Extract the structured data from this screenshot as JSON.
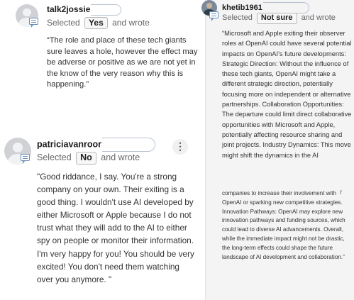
{
  "comments": [
    {
      "username": "talk2jossie",
      "selected_prefix": "Selected",
      "choice": "Yes",
      "selected_suffix": "and wrote",
      "text": "“The role and place of these tech giants sure leaves a hole, however the effect may be adverse or positive as we are not yet in the know of the very reason why this is happening.”"
    },
    {
      "username": "khetib1961",
      "selected_prefix": "Selected",
      "choice": "Not sure",
      "selected_suffix": "and wrote",
      "text_large": "“Microsoft and Apple exiting their observer roles at OpenAI could have several potential impacts on OpenAI's future developments: Strategic Direction: Without the influence of these tech giants, OpenAI might take a different strategic direction, potentially focusing more on independent or alternative partnerships. Collaboration Opportunities: The departure could limit direct collaborative opportunities with Microsoft and Apple, potentially affecting resource sharing and joint projects. Industry Dynamics: This move might shift the dynamics in the AI",
      "text_small": "companies to increase their involvement with OpenAI or sparking new competitive strategies. Innovation Pathways: OpenAI may explore new innovation pathways and funding sources, which could lead to diverse AI advancements. Overall, while the immediate impact might not be drastic, the long-term effects could shape the future landscape of AI development and collaboration.”",
      "stray_mark": "r"
    },
    {
      "username": "patriciavanroor",
      "selected_prefix": "Selected",
      "choice": "No",
      "selected_suffix": "and wrote",
      "text": "\"Good riddance, I say. You're a strong company on your own. Their exiting is a good thing. I wouldn't use AI developed by either Microsoft or Apple because I do not trust what they will add to the AI to either spy on people or monitor their information. I'm very happy for you! You should be very excited! You don't need them watching over you anymore. \"",
      "menu_glyph": "⋮"
    }
  ]
}
